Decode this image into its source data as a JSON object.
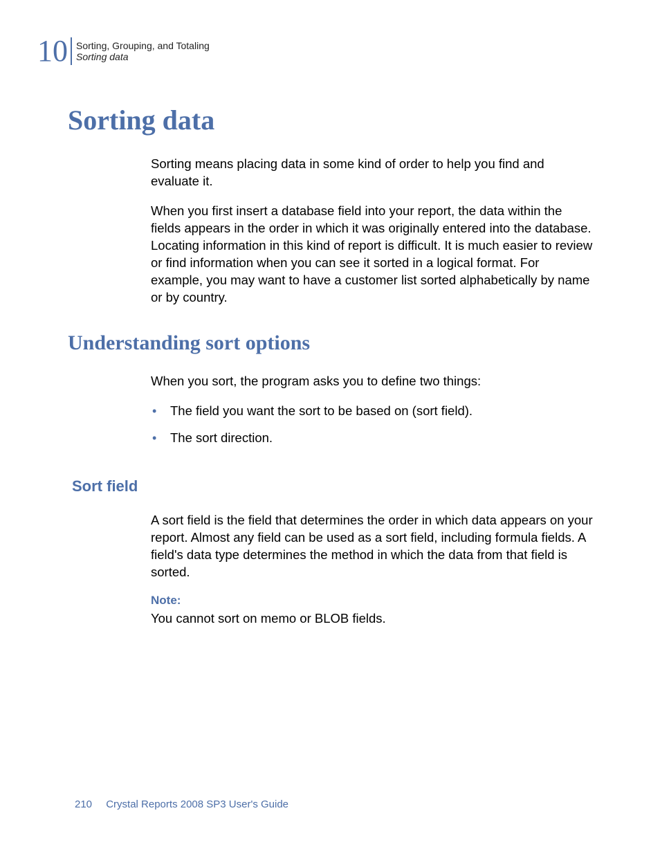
{
  "header": {
    "chapter_number": "10",
    "chapter_title": "Sorting, Grouping, and Totaling",
    "section_title": "Sorting data"
  },
  "main": {
    "h1": "Sorting data",
    "p1": "Sorting means placing data in some kind of order to help you find and evaluate it.",
    "p2": "When you first insert a database field into your report, the data within the fields appears in the order in which it was originally entered into the database. Locating information in this kind of report is difficult. It is much easier to review or find information when you can see it sorted in a logical format. For example, you may want to have a customer list sorted alphabetically by name or by country.",
    "h2": "Understanding sort options",
    "p3": "When you sort, the program asks you to define two things:",
    "bullets": [
      "The field you want the sort to be based on (sort field).",
      "The sort direction."
    ],
    "h3": "Sort field",
    "p4": "A sort field is the field that determines the order in which data appears on your report. Almost any field can be used as a sort field, including formula fields. A field's data type determines the method in which the data from that field is sorted.",
    "note_label": "Note:",
    "note_text": "You cannot sort on memo or BLOB fields."
  },
  "footer": {
    "page_number": "210",
    "book_title": "Crystal Reports 2008 SP3 User's Guide"
  }
}
